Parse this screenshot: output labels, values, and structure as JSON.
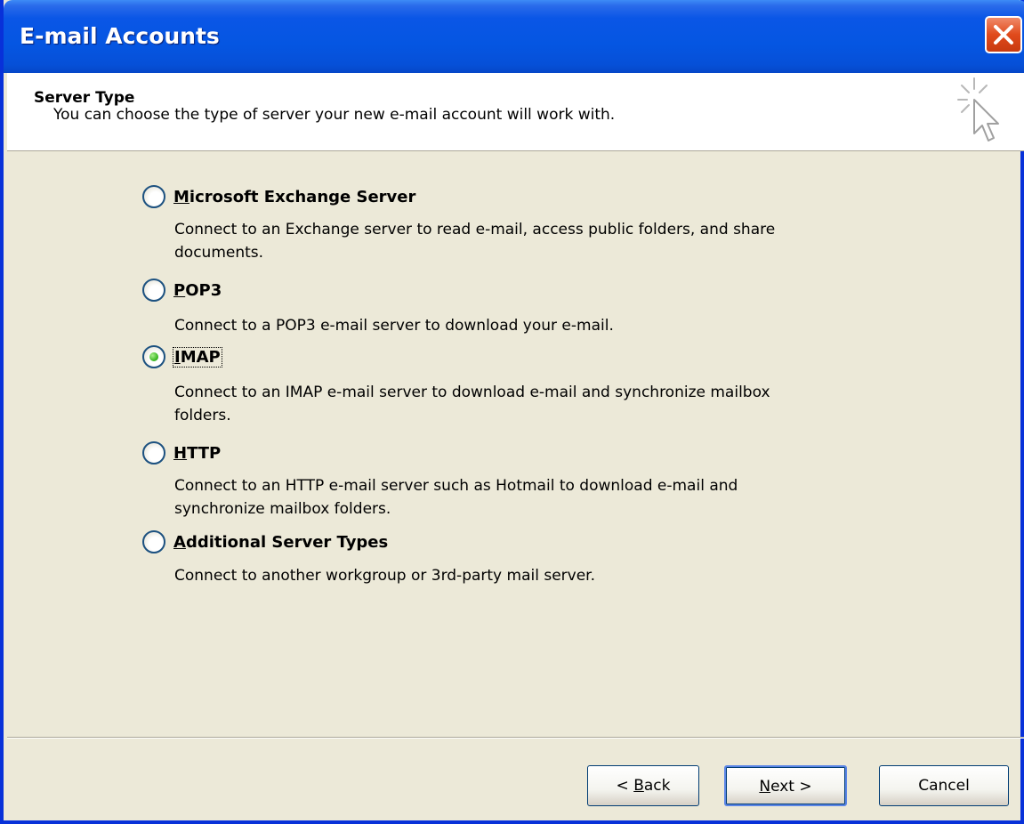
{
  "window": {
    "title": "E-mail Accounts"
  },
  "header": {
    "title": "Server Type",
    "subtitle": "You can choose the type of server your new e-mail account will work with."
  },
  "options": [
    {
      "access_key": "M",
      "label_rest": "icrosoft Exchange Server",
      "description_line1": "Connect to an Exchange server to read e-mail, access public folders, and share",
      "description_line2": "documents.",
      "selected": false
    },
    {
      "access_key": "P",
      "label_rest": "OP3",
      "description_line1": "Connect to a POP3 e-mail server to download your e-mail.",
      "description_line2": "",
      "selected": false
    },
    {
      "access_key": "I",
      "label_rest": "MAP",
      "description_line1": "Connect to an IMAP e-mail server to download e-mail and synchronize mailbox",
      "description_line2": "folders.",
      "selected": true
    },
    {
      "access_key": "H",
      "label_rest": "TTP",
      "description_line1": "Connect to an HTTP e-mail server such as Hotmail to download e-mail and",
      "description_line2": "synchronize mailbox folders.",
      "selected": false
    },
    {
      "access_key": "A",
      "label_rest": "dditional Server Types",
      "description_line1": "Connect to another workgroup or 3rd-party mail server.",
      "description_line2": "",
      "selected": false
    }
  ],
  "buttons": {
    "back_prefix": "< ",
    "back_key": "B",
    "back_rest": "ack",
    "next_key": "N",
    "next_rest": "ext >",
    "cancel": "Cancel"
  },
  "colors": {
    "titlebar": "#0556e2",
    "dialog_bg": "#ece9d8",
    "radio_selected": "#32b21a",
    "close_button": "#e04a1c"
  }
}
